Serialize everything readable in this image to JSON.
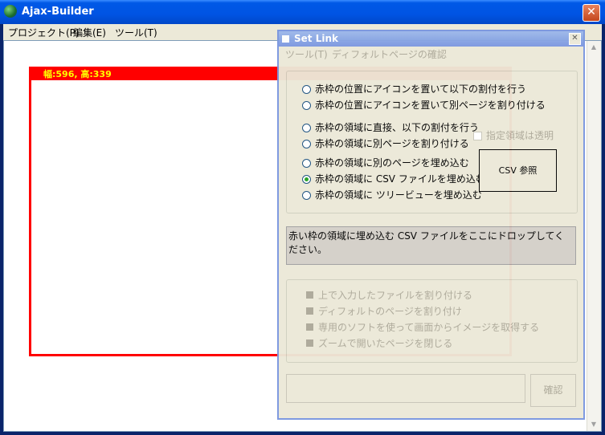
{
  "app": {
    "title": "Ajax-Builder",
    "close": "✕"
  },
  "menu": {
    "items": [
      "プロジェクト(P)",
      "編集(E)",
      "ツール(T)"
    ]
  },
  "overlay": {
    "label": "幅:596, 高:339"
  },
  "dialog": {
    "title": "Set Link",
    "close": "✕",
    "menu": [
      "ツール(T)",
      "ディフォルトページの確認"
    ],
    "options": [
      {
        "label": "赤枠の位置にアイコンを置いて以下の割付を行う",
        "checked": false
      },
      {
        "label": "赤枠の位置にアイコンを置いて別ページを割り付ける",
        "checked": false
      },
      {
        "label": "赤枠の領域に直接、以下の割付を行う",
        "checked": false
      },
      {
        "label": "赤枠の領域に別ページを割り付ける",
        "checked": false
      },
      {
        "label": "赤枠の領域に別のページを埋め込む",
        "checked": false
      },
      {
        "label": "赤枠の領域に CSV ファイルを埋め込む",
        "checked": true
      },
      {
        "label": "赤枠の領域に ツリービューを埋め込む",
        "checked": false
      }
    ],
    "transparent_checkbox": "指定領域は透明",
    "csv_button": "CSV 参照",
    "message": "赤い枠の領域に埋め込む CSV ファイルをここにドロップしてください。",
    "assign_items": [
      "上で入力したファイルを割り付ける",
      "ディフォルトのページを割り付け",
      "専用のソフトを使って画面からイメージを取得する",
      "ズームで開いたページを閉じる"
    ],
    "confirm_button": "確認"
  },
  "colors": {
    "accent": "#0054E3",
    "highlight": "#FF0000",
    "label_text": "#FFFF00"
  }
}
